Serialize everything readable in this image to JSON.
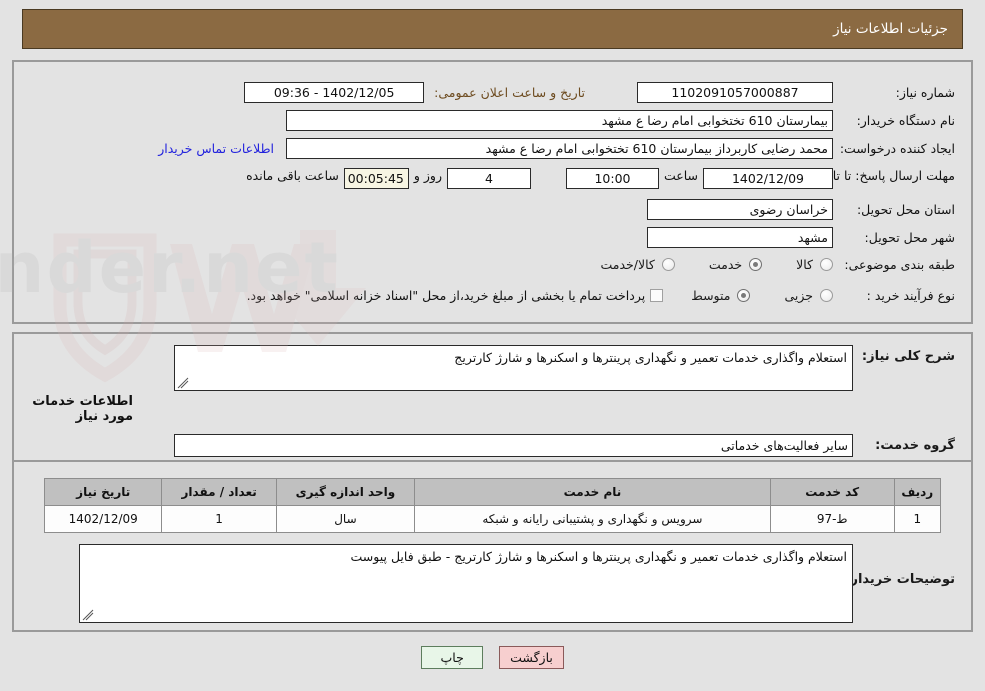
{
  "header": {
    "title": "جزئیات اطلاعات نیاز"
  },
  "top_form": {
    "need_number": {
      "label": "شماره نیاز:",
      "value": "1102091057000887"
    },
    "buyer_org": {
      "label": "نام دستگاه خریدار:",
      "value": "بیمارستان 610 تختخوابی امام رضا ع  مشهد"
    },
    "requester": {
      "label": "ایجاد کننده درخواست:",
      "value": "محمد رضایی کاربرداز بیمارستان 610 تختخوابی امام رضا ع  مشهد"
    },
    "contact_link": "اطلاعات تماس خریدار",
    "public_announce": {
      "label": "تاریخ و ساعت اعلان عمومی:",
      "value": "1402/12/05 - 09:36"
    },
    "deadline": {
      "label": "مهلت ارسال پاسخ: تا تاریخ:",
      "date": "1402/12/09",
      "time_label": "ساعت",
      "time": "10:00",
      "days": "4",
      "days_label": "روز و",
      "countdown": "00:05:45",
      "countdown_label": "ساعت باقی مانده"
    },
    "province": {
      "label": "استان محل تحویل:",
      "value": "خراسان رضوی"
    },
    "city": {
      "label": "شهر محل تحویل:",
      "value": "مشهد"
    },
    "category": {
      "label": "طبقه بندی موضوعی:",
      "options": [
        "کالا",
        "خدمت",
        "کالا/خدمت"
      ],
      "selected": "خدمت"
    },
    "purchase_type": {
      "label": "نوع فرآیند خرید :",
      "options": [
        "جزیی",
        "متوسط"
      ],
      "selected": "متوسط",
      "treasury_note": "پرداخت تمام یا بخشی از مبلغ خرید،از محل \"اسناد خزانه اسلامی\" خواهد بود.",
      "treasury_checked": false
    }
  },
  "middle": {
    "general_desc_label": "شرح کلی نیاز:",
    "general_desc_value": "استعلام واگذاری خدمات تعمیر و نگهداری پرینترها و اسکنرها و شارژ کارتریج",
    "section_title": "اطلاعات خدمات مورد نیاز",
    "service_group_label": "گروه خدمت:",
    "service_group_value": "سایر فعالیت‌های خدماتی"
  },
  "items_table": {
    "columns": [
      "ردیف",
      "کد خدمت",
      "نام خدمت",
      "واحد اندازه گیری",
      "تعداد / مقدار",
      "تاریخ نیاز"
    ],
    "rows": [
      {
        "row": "1",
        "code": "ط-97",
        "name": "سرویس و نگهداری و پشتیبانی رایانه و شبکه",
        "unit": "سال",
        "qty": "1",
        "need_date": "1402/12/09"
      }
    ]
  },
  "buyer_notes": {
    "label": "توضیحات خریدار:",
    "value": "استعلام واگذاری خدمات تعمیر و نگهداری پرینترها و اسکنرها و شارژ کارتریج - طبق فایل پیوست"
  },
  "footer": {
    "print_label": "چاپ",
    "back_label": "بازگشت"
  },
  "colors": {
    "header_bg": "#8b6a42",
    "page_bg": "#e3e3e3",
    "link": "#2222dd",
    "accent_label": "#6d4b1f",
    "print_btn": "#e8f6e8",
    "back_btn": "#f7cfcf"
  },
  "watermark": {
    "text": "AriaTender.net"
  }
}
